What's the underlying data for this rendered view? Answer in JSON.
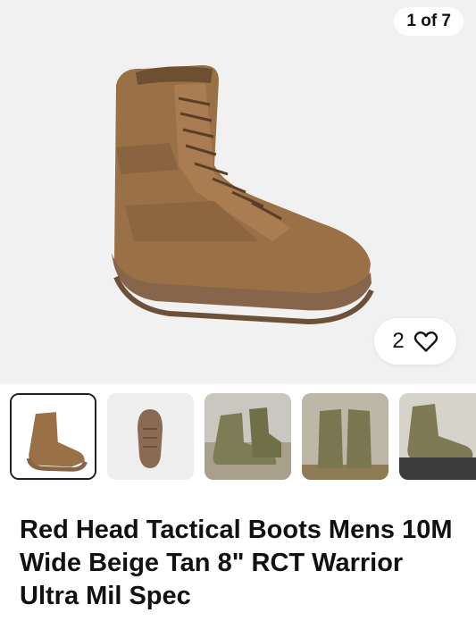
{
  "gallery": {
    "counter": "1 of 7",
    "current_image_icon": "tan-tactical-boot",
    "watch_count": "2",
    "watch_icon": "heart-outline-icon",
    "thumbnails": [
      {
        "icon": "boot-side-view",
        "selected": true
      },
      {
        "icon": "boot-sole-view",
        "selected": false
      },
      {
        "icon": "boot-pair-green-background",
        "selected": false
      },
      {
        "icon": "boot-pair-front-view",
        "selected": false
      },
      {
        "icon": "boot-on-floor-mat",
        "selected": false
      }
    ]
  },
  "listing": {
    "title": "Red Head Tactical Boots Mens 10M Wide Beige Tan 8\" RCT Warrior Ultra Mil Spec"
  },
  "colors": {
    "boot_tan": "#9a7046",
    "sole": "#86654a",
    "selected_border": "#222222"
  }
}
